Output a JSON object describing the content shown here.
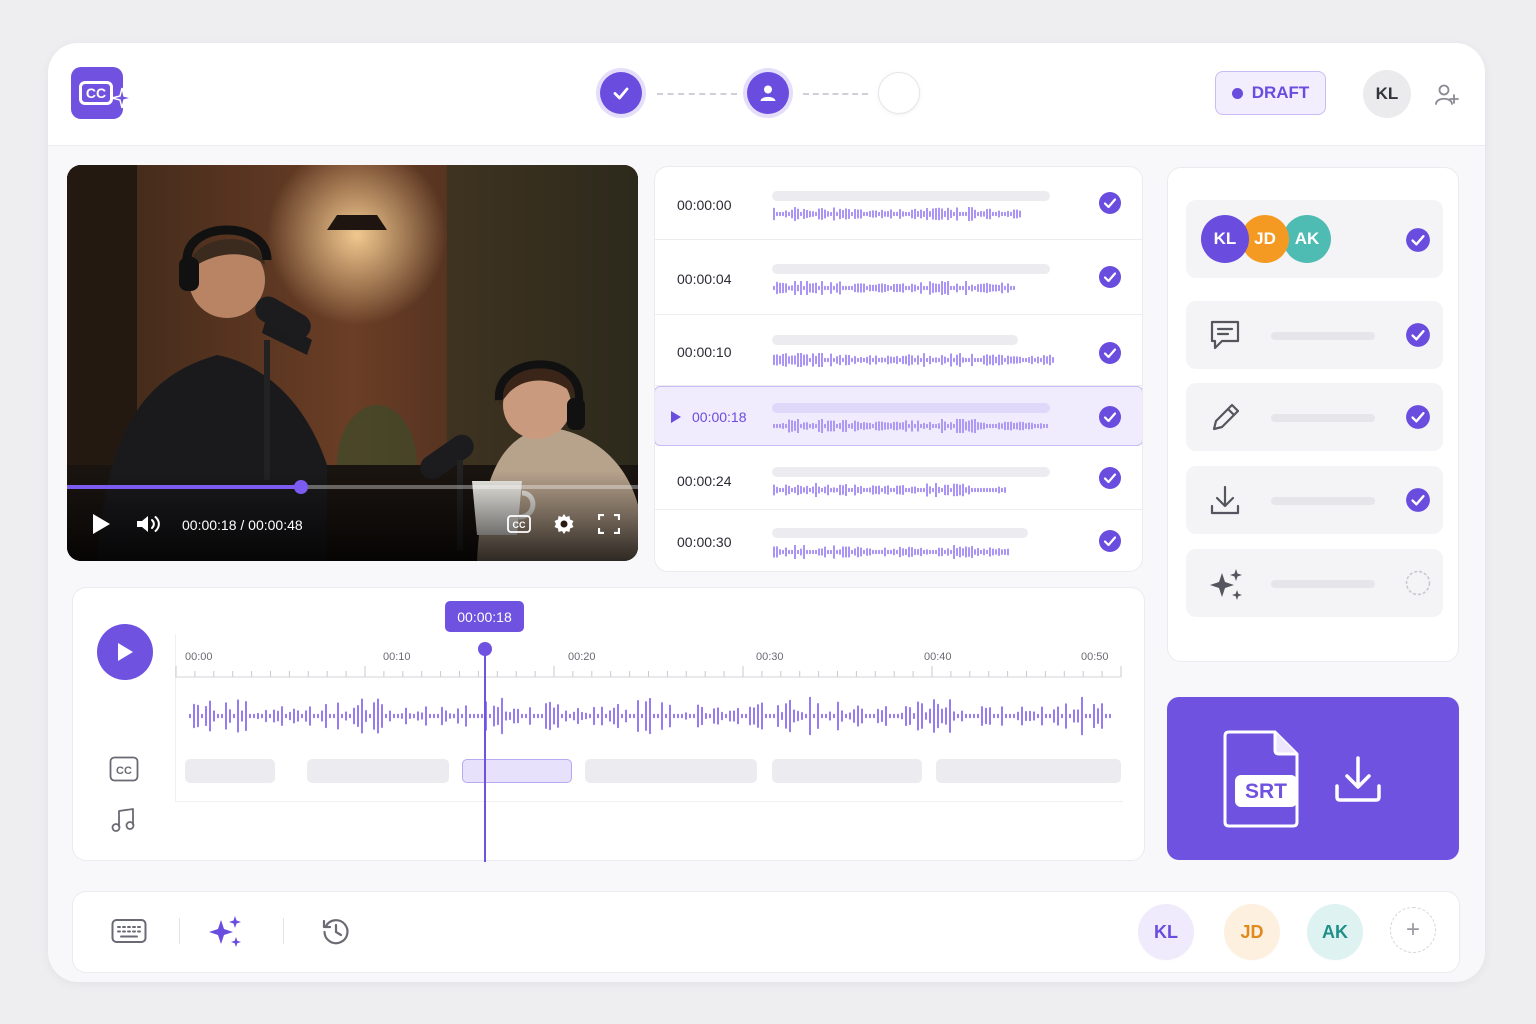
{
  "app": {
    "logo_text": "CC"
  },
  "header": {
    "status_label": "DRAFT",
    "user_initials": "KL"
  },
  "video": {
    "time_display": "00:00:18 / 00:00:48",
    "progress": 0.41
  },
  "transcript": {
    "rows": [
      {
        "time": "00:00:00",
        "done": true
      },
      {
        "time": "00:00:04",
        "done": true
      },
      {
        "time": "00:00:10",
        "done": true
      },
      {
        "time": "00:00:18",
        "done": true,
        "selected": true
      },
      {
        "time": "00:00:24",
        "done": true
      },
      {
        "time": "00:00:30",
        "done": true
      }
    ]
  },
  "sidebar": {
    "collaborators": [
      "KL",
      "JD",
      "AK"
    ],
    "tasks": [
      {
        "icon": "comment-icon",
        "done": true
      },
      {
        "icon": "pencil-icon",
        "done": true
      },
      {
        "icon": "download-icon",
        "done": true
      },
      {
        "icon": "sparkle-icon",
        "done": false
      }
    ]
  },
  "export": {
    "format_label": "SRT"
  },
  "timeline": {
    "playhead_label": "00:00:18",
    "ticks": [
      "00:00",
      "00:10",
      "00:20",
      "00:30",
      "00:40",
      "00:50"
    ]
  },
  "bottombar": {
    "avatars": [
      {
        "initials": "KL",
        "color": "#6a4cde",
        "bg": "#efebfc"
      },
      {
        "initials": "JD",
        "color": "#e08a1e",
        "bg": "#fdf0df"
      },
      {
        "initials": "AK",
        "color": "#1f8f88",
        "bg": "#def3f1"
      }
    ],
    "add_label": "+"
  },
  "colors": {
    "accent": "#6f52e0",
    "accent_light": "#f0ecfd",
    "avatar_kl": "#6a4cde",
    "avatar_jd": "#f49a22",
    "avatar_ak": "#4fbcb4"
  }
}
